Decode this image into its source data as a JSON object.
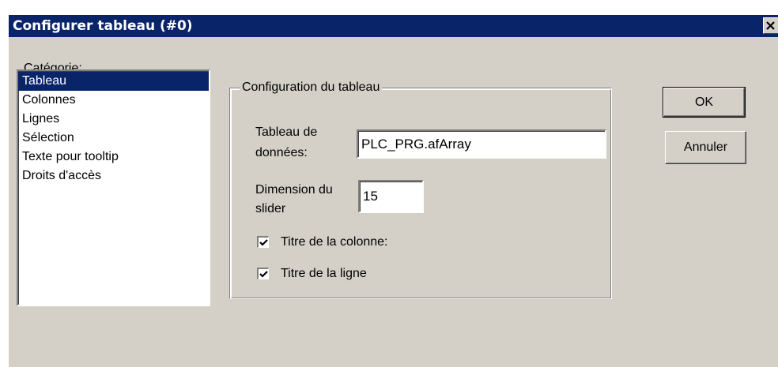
{
  "window": {
    "title": "Configurer tableau (#0)"
  },
  "category": {
    "label": "Catégorie:",
    "items": [
      {
        "label": "Tableau",
        "selected": true
      },
      {
        "label": "Colonnes",
        "selected": false
      },
      {
        "label": "Lignes",
        "selected": false
      },
      {
        "label": "Sélection",
        "selected": false
      },
      {
        "label": "Texte pour tooltip",
        "selected": false
      },
      {
        "label": "Droits d'accès",
        "selected": false
      }
    ]
  },
  "config": {
    "group_title": "Configuration du tableau",
    "data_array_label_line1": "Tableau de",
    "data_array_label_line2": "données:",
    "data_array_value": "PLC_PRG.afArray",
    "slider_label_line1": "Dimension du",
    "slider_label_line2": "slider",
    "slider_value": "15",
    "column_title_label": "Titre de la colonne:",
    "column_title_checked": true,
    "row_title_label": "Titre de la ligne",
    "row_title_checked": true
  },
  "buttons": {
    "ok": "OK",
    "cancel": "Annuler"
  },
  "colors": {
    "titlebar": "#0a246a",
    "selection": "#0a246a",
    "face": "#d4d0c8"
  },
  "icons": {
    "close": "close-icon",
    "check": "check-icon"
  }
}
